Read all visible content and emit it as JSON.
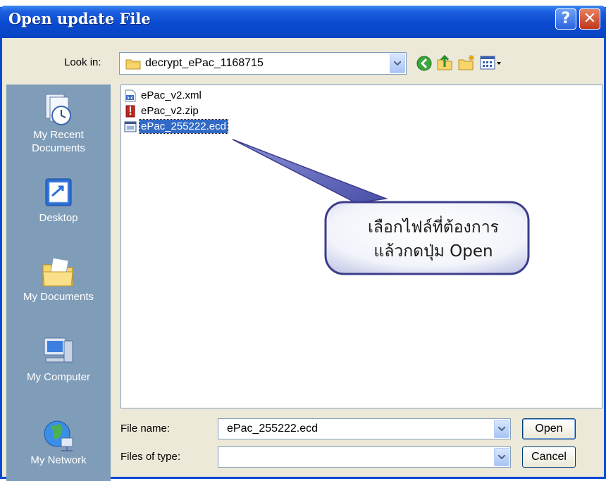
{
  "window": {
    "title": "Open update File",
    "help_label": "?",
    "close_label": "✕"
  },
  "look_in": {
    "label": "Look in:",
    "value": "decrypt_ePac_1168715",
    "folder_icon": "folder-icon"
  },
  "toolbar": {
    "icons": [
      "back-icon",
      "up-folder-icon",
      "new-folder-icon",
      "view-menu-icon"
    ]
  },
  "places": [
    {
      "label_line1": "My Recent",
      "label_line2": "Documents",
      "icon": "recent-documents-icon"
    },
    {
      "label_line1": "Desktop",
      "label_line2": "",
      "icon": "desktop-icon"
    },
    {
      "label_line1": "My Documents",
      "label_line2": "",
      "icon": "my-documents-icon"
    },
    {
      "label_line1": "My Computer",
      "label_line2": "",
      "icon": "my-computer-icon"
    },
    {
      "label_line1": "My Network",
      "label_line2": "",
      "icon": "my-network-icon"
    }
  ],
  "files": [
    {
      "name": "ePac_v2.xml",
      "icon": "xml-file-icon",
      "selected": false
    },
    {
      "name": "ePac_v2.zip",
      "icon": "zip-file-icon",
      "selected": false
    },
    {
      "name": "ePac_255222.ecd",
      "icon": "ecd-file-icon",
      "selected": true
    }
  ],
  "callout": {
    "line1": "เลือกไฟล์ที่ต้องการ",
    "line2": "แล้วกดปุ่ม Open"
  },
  "form": {
    "file_name_label": "File name:",
    "file_name_value": "ePac_255222.ecd",
    "files_of_type_label": "Files of type:",
    "files_of_type_value": ""
  },
  "buttons": {
    "open": "Open",
    "cancel": "Cancel"
  },
  "colors": {
    "titlebar": "#0a4ad0",
    "selection": "#316ac5",
    "callout_border": "#3c3c8c"
  }
}
